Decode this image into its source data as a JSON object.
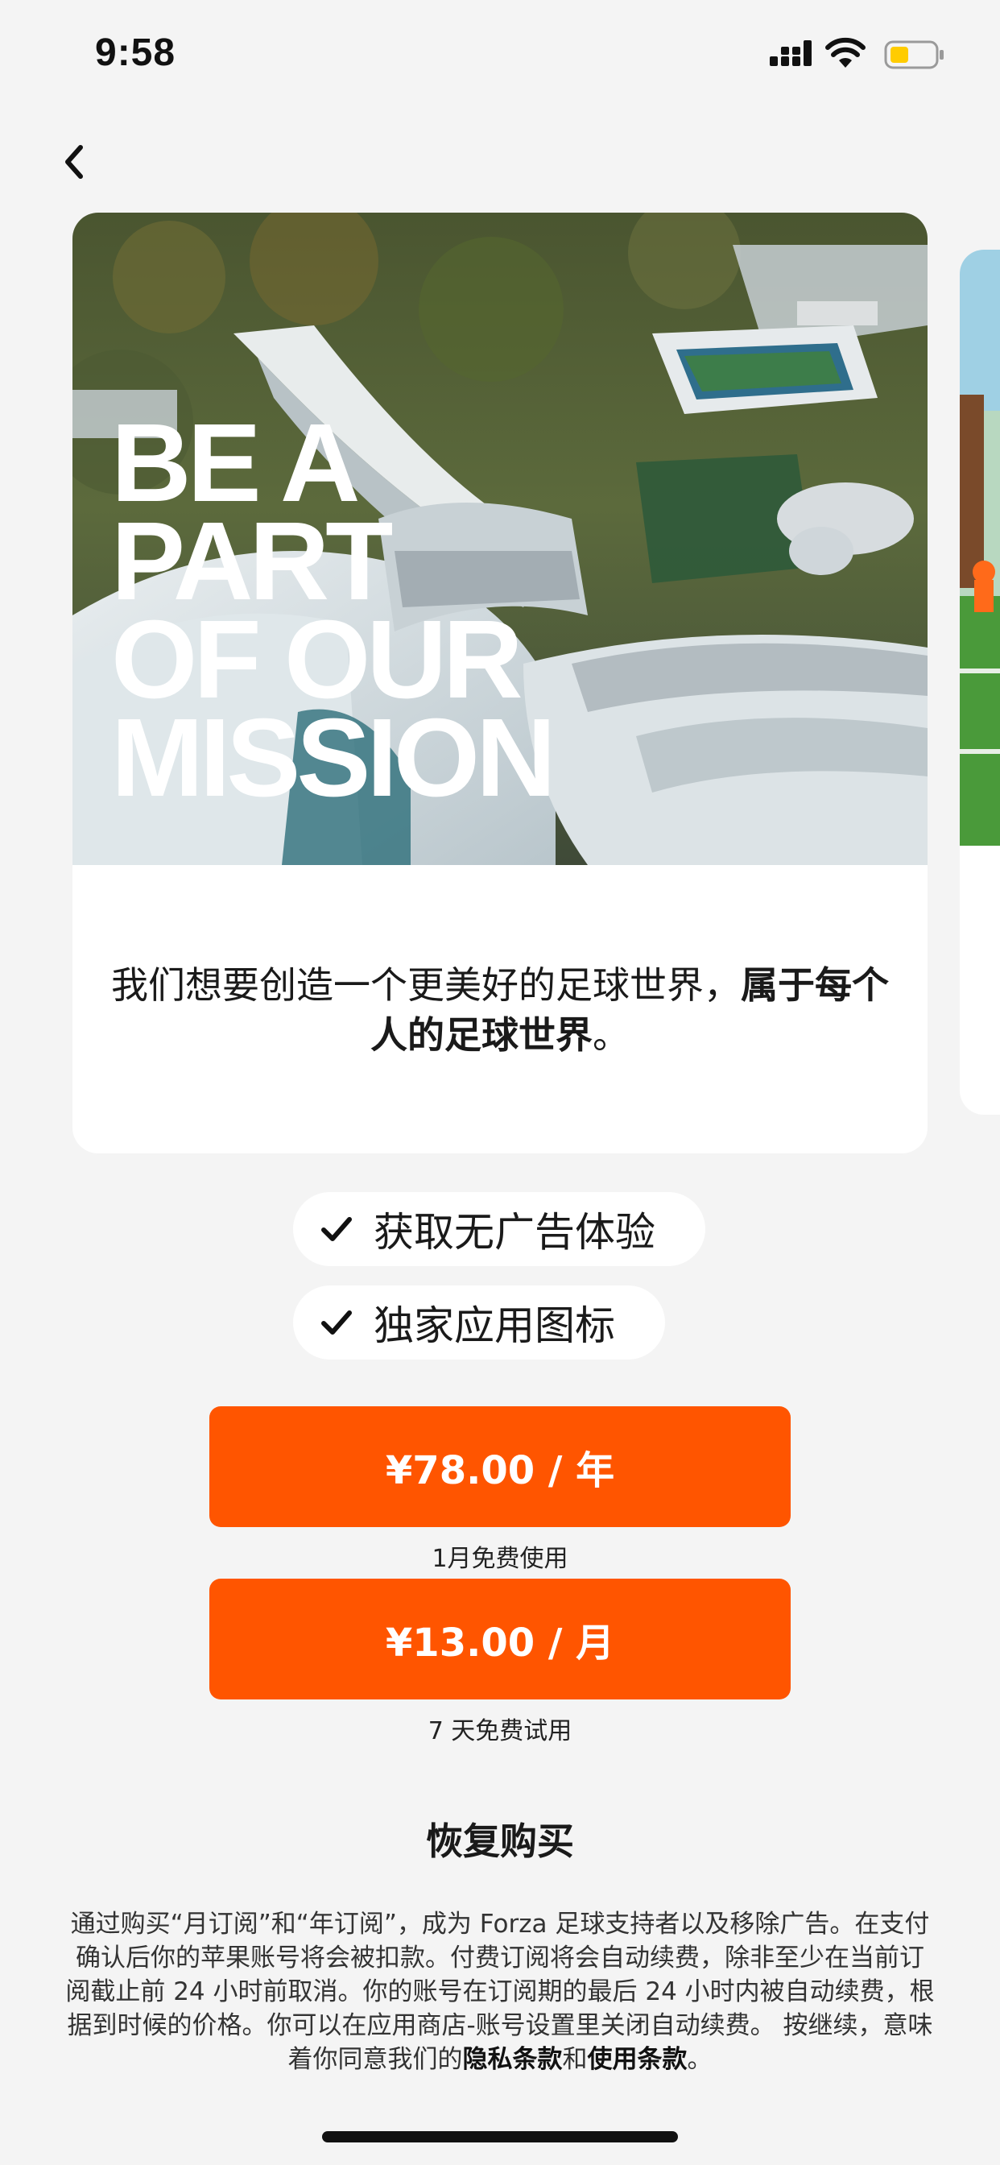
{
  "status_bar": {
    "time": "9:58"
  },
  "icons": {
    "back": "chevron-left-icon",
    "check": "checkmark-icon",
    "signal": "cellular-signal-icon",
    "wifi": "wifi-icon",
    "battery": "battery-low-icon"
  },
  "colors": {
    "accent": "#ff5500",
    "background": "#f4f4f4",
    "battery_fill": "#ffcc00"
  },
  "card": {
    "headline_lines": [
      "BE A",
      "PART",
      "OF OUR",
      "MISSION"
    ],
    "text_regular": "我们想要创造一个更美好的足球世界，",
    "text_bold": "属于每个人的足球世界",
    "text_end": "。"
  },
  "features": [
    {
      "label": "获取无广告体验"
    },
    {
      "label": "独家应用图标"
    }
  ],
  "plans": [
    {
      "price_label": "¥78.00 / 年",
      "caption": "1月免费使用"
    },
    {
      "price_label": "¥13.00 / 月",
      "caption": "7 天免费试用"
    }
  ],
  "restore_label": "恢复购买",
  "legal": {
    "text": "通过购买“月订阅”和“年订阅”，成为 Forza 足球支持者以及移除广告。在支付确认后你的苹果账号将会被扣款。付费订阅将会自动续费，除非至少在当前订阅截止前 24 小时前取消。你的账号在订阅期的最后 24 小时内被自动续费，根据到时候的价格。你可以在应用商店-账号设置里关闭自动续费。 按继续，意味着你同意我们的",
    "privacy_link": "隐私条款",
    "and": "和",
    "terms_link": "使用条款",
    "end": "。"
  }
}
